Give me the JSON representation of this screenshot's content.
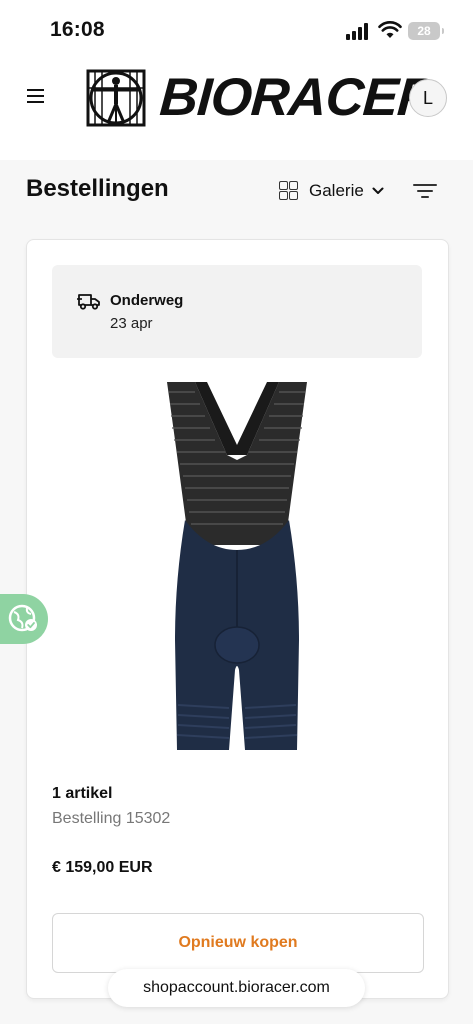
{
  "status_bar": {
    "time": "16:08",
    "battery": "28",
    "icons": [
      "signal-icon",
      "wifi-icon",
      "battery-icon"
    ]
  },
  "header": {
    "brand": "BIORACER",
    "avatar_initial": "L",
    "icons": [
      "menu-icon",
      "vitruvian-logo-icon"
    ]
  },
  "page": {
    "title": "Bestellingen",
    "view_label": "Galerie",
    "icons": [
      "grid-icon",
      "chevron-down-icon",
      "filter-icon"
    ]
  },
  "order": {
    "status": "Onderweg",
    "date": "23 apr",
    "items_count": "1 artikel",
    "order_number": "Bestelling 15302",
    "price": "€ 159,00 EUR",
    "reorder_label": "Opnieuw kopen",
    "accent_color": "#e07a1f",
    "icons": [
      "truck-icon",
      "bib-shorts-image"
    ]
  },
  "floating": {
    "icons": [
      "eco-globe-icon"
    ],
    "color": "#8fd3a2"
  },
  "browser": {
    "url": "shopaccount.bioracer.com"
  }
}
